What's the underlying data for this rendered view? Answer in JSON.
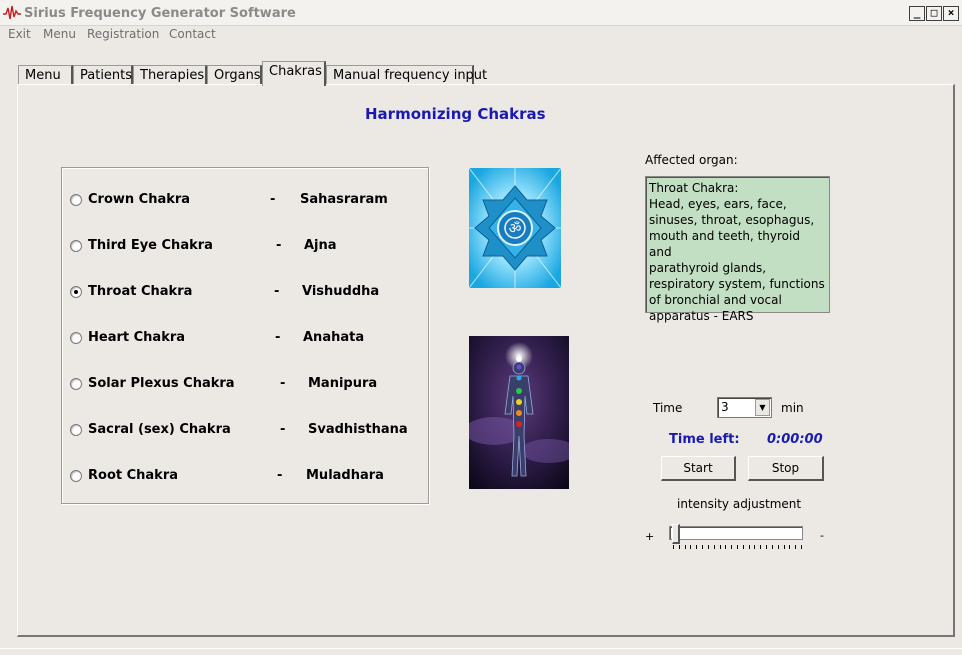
{
  "window": {
    "title": "Sirius Frequency Generator Software",
    "minimize": "_",
    "maximize": "□",
    "close": "×"
  },
  "menubar": [
    "Exit",
    "Menu",
    "Registration",
    "Contact"
  ],
  "tabs": [
    {
      "label": "Menu"
    },
    {
      "label": "Patients"
    },
    {
      "label": "Therapies"
    },
    {
      "label": "Organs"
    },
    {
      "label": "Chakras",
      "active": true
    },
    {
      "label": "Manual frequency input"
    }
  ],
  "heading": "Harmonizing Chakras",
  "chakras": [
    {
      "name": "Crown Chakra",
      "dash": "-",
      "sanskrit": "Sahasraram",
      "checked": false
    },
    {
      "name": "Third Eye Chakra",
      "dash": "-",
      "sanskrit": "Ajna",
      "checked": false
    },
    {
      "name": "Throat Chakra",
      "dash": "-",
      "sanskrit": "Vishuddha",
      "checked": true
    },
    {
      "name": "Heart Chakra",
      "dash": "-",
      "sanskrit": "Anahata",
      "checked": false
    },
    {
      "name": "Solar Plexus Chakra",
      "dash": "-",
      "sanskrit": "Manipura",
      "checked": false
    },
    {
      "name": "Sacral (sex) Chakra",
      "dash": "-",
      "sanskrit": "Svadhisthana",
      "checked": false
    },
    {
      "name": "Root Chakra",
      "dash": "-",
      "sanskrit": "Muladhara",
      "checked": false
    }
  ],
  "affected": {
    "label": "Affected organ:",
    "text": "Throat Chakra:\nHead, eyes, ears, face,\nsinuses, throat, esophagus,\nmouth and teeth, thyroid and\nparathyroid glands,\nrespiratory system, functions\nof bronchial and vocal\napparatus - EARS"
  },
  "timer": {
    "time_label": "Time",
    "time_value": "3",
    "unit": "min",
    "time_left_label": "Time left:",
    "time_left_value": "0:00:00",
    "start": "Start",
    "stop": "Stop"
  },
  "intensity": {
    "label": "intensity adjustment",
    "plus": "+",
    "minus": "-",
    "level": 0
  },
  "colors": {
    "accent_blue": "#1a1ab0",
    "organ_box_bg": "#c3dfc3",
    "throat_chakra_blue": "#2a9fd8"
  }
}
